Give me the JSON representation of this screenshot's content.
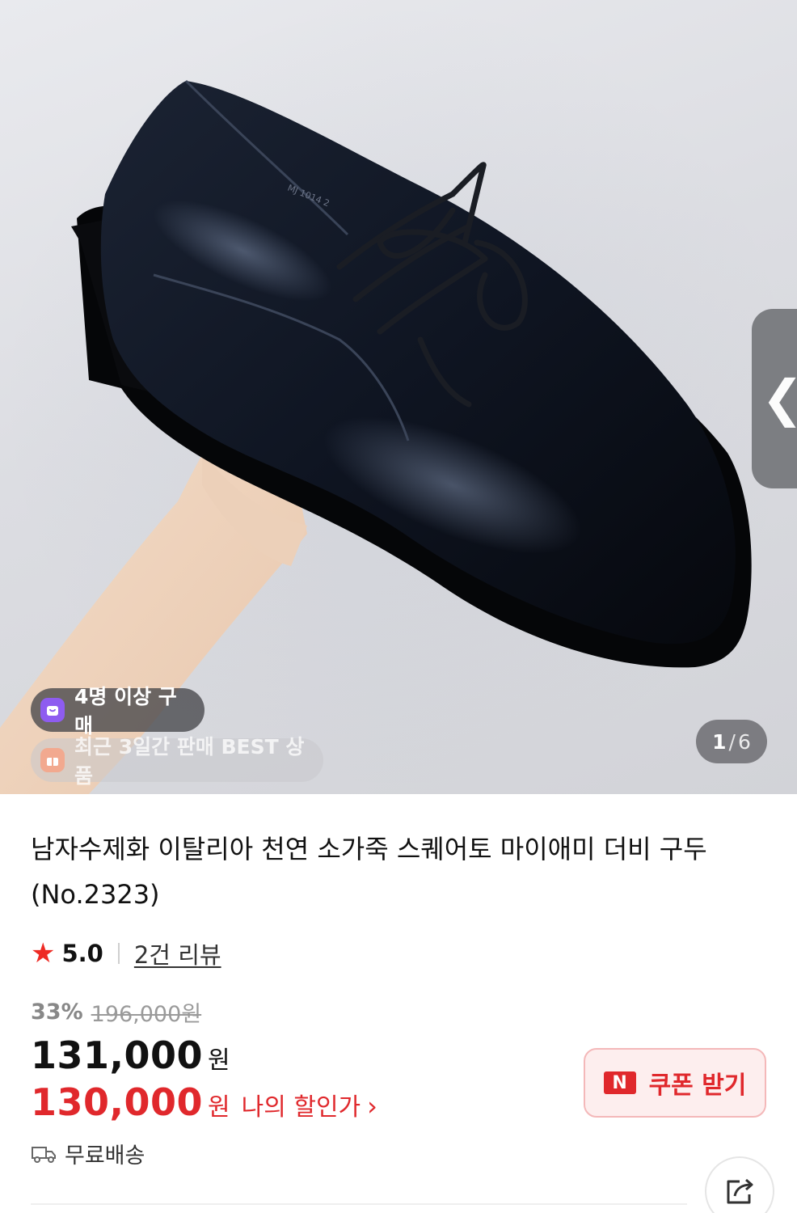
{
  "gallery": {
    "current": "1",
    "separator": "/",
    "total": "6",
    "badge_buyers": "4명 이상 구매",
    "badge_best": "최근 3일간 판매 BEST 상품",
    "side_handle_glyph": "❮",
    "shoe_imprint": "MJ 1014 2"
  },
  "product": {
    "title": "남자수제화 이탈리아 천연 소가죽 스퀘어토 마이애미 더비 구두 (No.2323)",
    "rating": {
      "star_icon": "★",
      "score": "5.0",
      "reviews": "2건 리뷰"
    },
    "price": {
      "discount_percent": "33%",
      "original": "196,000원",
      "sale": "131,000",
      "sale_unit": "원",
      "my_price": "130,000",
      "my_price_unit": "원",
      "my_price_label": "나의 할인가",
      "my_price_arrow": "›"
    },
    "coupon": {
      "icon_text": "N",
      "label": "쿠폰 받기"
    },
    "shipping": "무료배송"
  },
  "colors": {
    "accent_red": "#e0282c",
    "star_red": "#ee2a24",
    "badge_purple": "#8e5cf0"
  },
  "icons": {
    "star": "star-icon",
    "truck": "truck-icon",
    "share": "share-icon",
    "bag": "shopping-bag-icon",
    "gift": "gift-icon"
  }
}
